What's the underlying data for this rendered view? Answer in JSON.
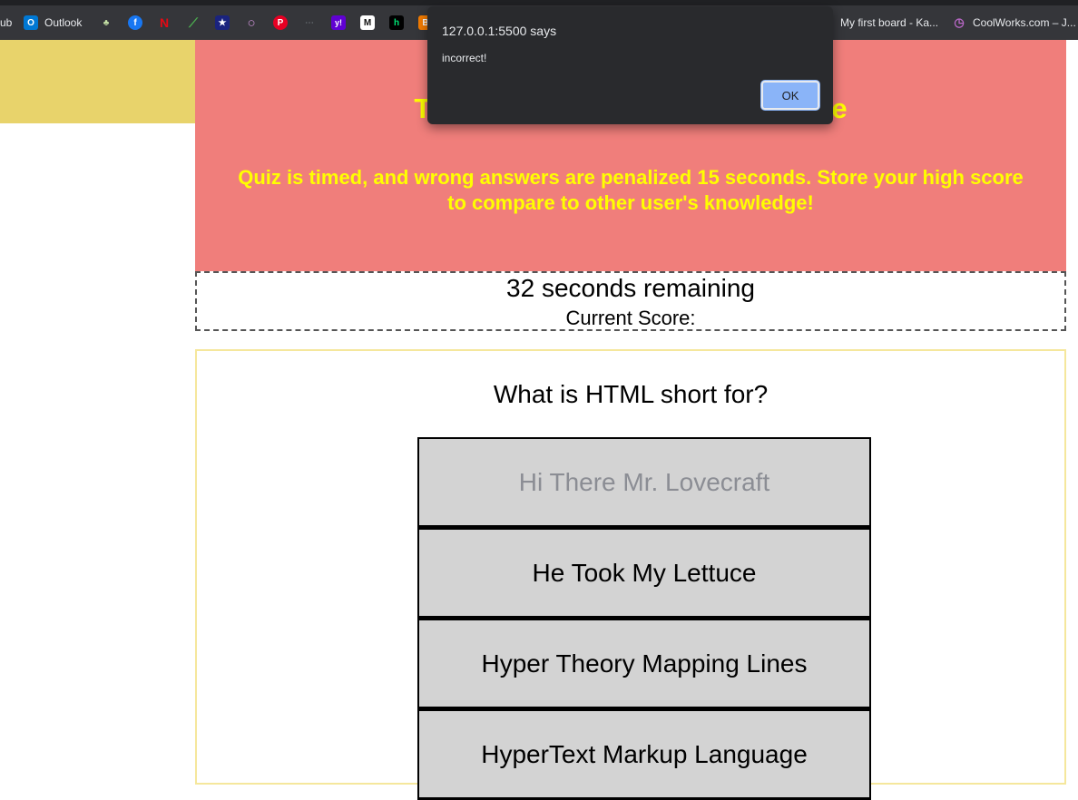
{
  "bookmarks": [
    {
      "label": "ub",
      "icon": "github-icon"
    },
    {
      "label": "Outlook",
      "icon": "outlook-icon",
      "color": "#0078d4",
      "glyph": "O"
    },
    {
      "label": "",
      "icon": "bottle-icon",
      "color": "#6b8e23",
      "glyph": "♣"
    },
    {
      "label": "",
      "icon": "facebook-icon",
      "color": "#1877f2",
      "glyph": "f"
    },
    {
      "label": "",
      "icon": "netflix-icon",
      "color": "#e50914",
      "glyph": "N"
    },
    {
      "label": "",
      "icon": "mlb-icon",
      "color": "#2e7d32",
      "glyph": "⟋"
    },
    {
      "label": "",
      "icon": "star-icon",
      "color": "#1a237e",
      "glyph": "★"
    },
    {
      "label": "",
      "icon": "ring-icon",
      "color": "#7b5ea7",
      "glyph": "○"
    },
    {
      "label": "",
      "icon": "pinterest-icon",
      "color": "#e60023",
      "glyph": "P"
    },
    {
      "label": "",
      "icon": "dots-icon",
      "color": "#3c3c3c",
      "glyph": "⋯"
    },
    {
      "label": "",
      "icon": "yahoo-icon",
      "color": "#6001d2",
      "glyph": "y!"
    },
    {
      "label": "",
      "icon": "m-icon",
      "color": "#111111",
      "glyph": "M"
    },
    {
      "label": "",
      "icon": "h-icon",
      "color": "#000000",
      "glyph": "h"
    },
    {
      "label": "",
      "icon": "b-icon",
      "color": "#f57c00",
      "glyph": "B"
    },
    {
      "label": "My first board - Ka...",
      "icon": "trello-icon",
      "color": "#0079bf",
      "glyph": "▦"
    },
    {
      "label": "CoolWorks.com – J...",
      "icon": "coolworks-icon",
      "color": "#8e24aa",
      "glyph": "◷"
    }
  ],
  "header": {
    "title": "Test Your JavaScript Knowledge",
    "subtitle": "Quiz is timed, and wrong answers are penalized 15 seconds. Store your high score to compare to other user's knowledge!"
  },
  "timer": {
    "text": "32 seconds remaining",
    "score_label": "Current Score:"
  },
  "quiz": {
    "question": "What is HTML short for?",
    "answers": [
      "Hi There Mr. Lovecraft",
      "He Took My Lettuce",
      "Hyper Theory Mapping Lines",
      "HyperText Markup Language"
    ]
  },
  "alert": {
    "origin": "127.0.0.1:5500 says",
    "message": "incorrect!",
    "ok_label": "OK"
  },
  "colors": {
    "header_bg": "#f07e7b",
    "header_text": "#ffff00",
    "side_accent": "#e8d36b",
    "answer_bg": "#d3d3d3",
    "alert_bg": "#292a2d",
    "ok_button": "#8ab4f8"
  }
}
